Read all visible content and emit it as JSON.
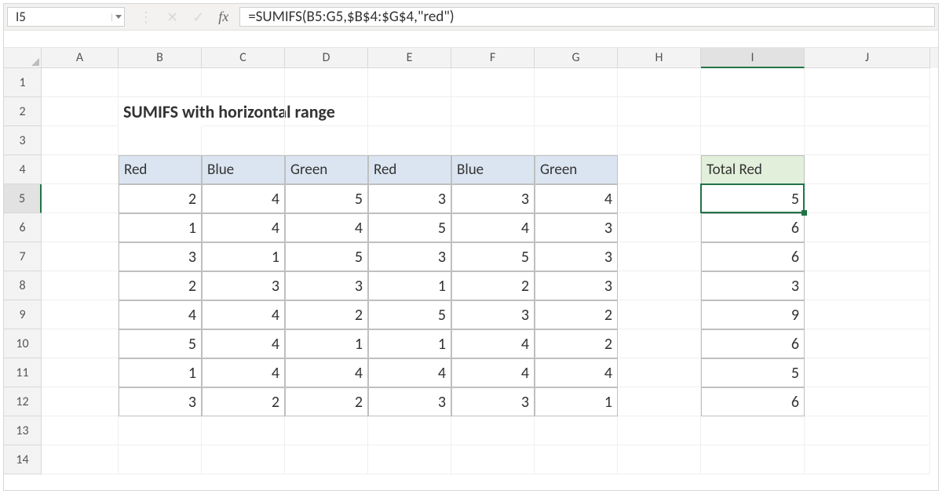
{
  "namebox": {
    "ref": "I5"
  },
  "fbar": {
    "cancel_glyph": "✕",
    "accept_glyph": "✓",
    "fx_glyph": "fx",
    "formula": "=SUMIFS(B5:G5,$B$4:$G$4,\"red\")"
  },
  "columns": [
    "A",
    "B",
    "C",
    "D",
    "E",
    "F",
    "G",
    "H",
    "I",
    "J"
  ],
  "active_col": "I",
  "row_numbers": [
    1,
    2,
    3,
    4,
    5,
    6,
    7,
    8,
    9,
    10,
    11,
    12,
    13,
    14
  ],
  "active_row": 5,
  "title": "SUMIFS with horizontal range",
  "table": {
    "headers": [
      "Red",
      "Blue",
      "Green",
      "Red",
      "Blue",
      "Green"
    ],
    "rows": [
      [
        2,
        4,
        5,
        3,
        3,
        4
      ],
      [
        1,
        4,
        4,
        5,
        4,
        3
      ],
      [
        3,
        1,
        5,
        3,
        5,
        3
      ],
      [
        2,
        3,
        3,
        1,
        2,
        3
      ],
      [
        4,
        4,
        2,
        5,
        3,
        2
      ],
      [
        5,
        4,
        1,
        1,
        4,
        2
      ],
      [
        1,
        4,
        4,
        4,
        4,
        4
      ],
      [
        3,
        2,
        2,
        3,
        3,
        1
      ]
    ]
  },
  "totals": {
    "header": "Total Red",
    "values": [
      5,
      6,
      6,
      3,
      9,
      6,
      5,
      6
    ]
  },
  "chart_data": null
}
